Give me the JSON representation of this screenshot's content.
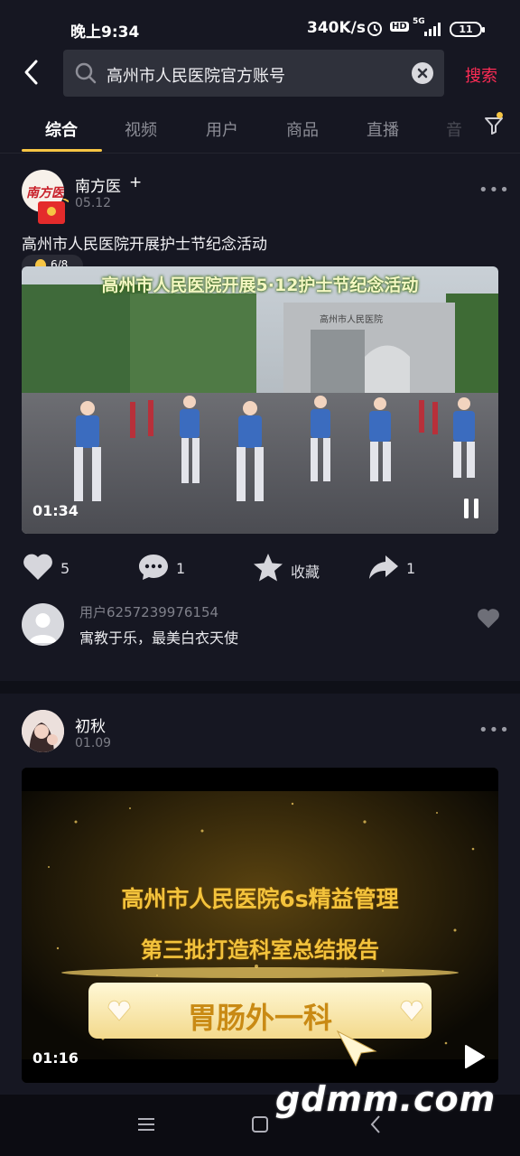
{
  "status": {
    "time": "晚上9:34",
    "speed": "340K/s",
    "battery": "11",
    "net": "5G",
    "hd": "HD"
  },
  "search": {
    "query": "高州市人民医院官方账号",
    "submit": "搜索"
  },
  "tabs": [
    "综合",
    "视频",
    "用户",
    "商品",
    "直播",
    "音"
  ],
  "posts": [
    {
      "author": "南方医",
      "follow": "+",
      "date": "05.12",
      "caption": "高州市人民医院开展护士节纪念活动",
      "badge": "6/8",
      "video_title": "高州市人民医院开展5·12护士节纪念活动",
      "gate_text": "高州市人民医院",
      "duration": "01:34",
      "likes": "5",
      "comments": "1",
      "favorite_label": "收藏",
      "shares": "1",
      "top_comment": {
        "user": "用户6257239976154",
        "text": "寓教于乐，最美白衣天使"
      }
    },
    {
      "author": "初秋",
      "date": "01.09",
      "video_line1": "高州市人民医院6s精益管理",
      "video_line2": "第三批打造科室总结报告",
      "video_line3": "胃肠外一科",
      "duration": "01:16"
    }
  ],
  "watermark": "gdmm.com",
  "colors": {
    "accent": "#fe2c55",
    "tab_indicator": "#f6c544",
    "background": "#161722"
  }
}
